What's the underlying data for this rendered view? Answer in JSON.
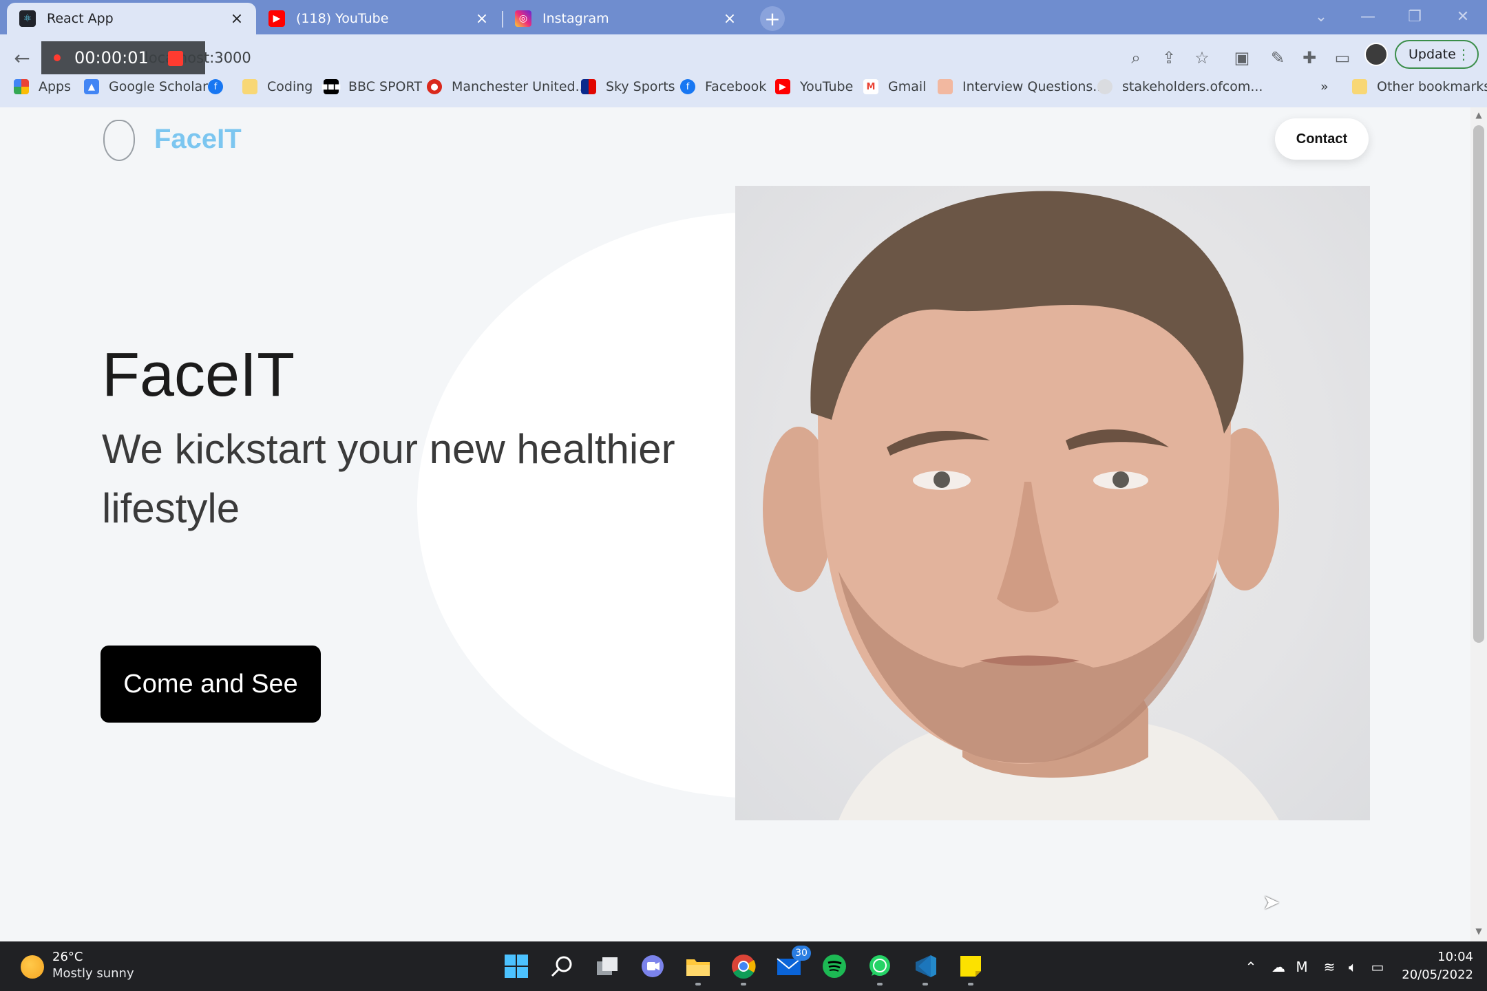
{
  "browser": {
    "tabs": [
      {
        "title": "React App"
      },
      {
        "title": "(118) YouTube"
      },
      {
        "title": "Instagram"
      }
    ],
    "url": "localhost:3000",
    "recorder_time": "00:00:01",
    "update_label": "Update",
    "bookmarks": [
      {
        "label": "Apps"
      },
      {
        "label": "Google Scholar"
      },
      {
        "label": ""
      },
      {
        "label": "Coding"
      },
      {
        "label": "BBC SPORT"
      },
      {
        "label": "Manchester United..."
      },
      {
        "label": "Sky Sports"
      },
      {
        "label": "Facebook"
      },
      {
        "label": "YouTube"
      },
      {
        "label": "Gmail"
      },
      {
        "label": "Interview Questions..."
      },
      {
        "label": "stakeholders.ofcom..."
      }
    ],
    "bookmarks_overflow": "»",
    "other_bookmarks": "Other bookmarks"
  },
  "page": {
    "logo_text": "FaceIT",
    "contact_label": "Contact",
    "hero_title": "FaceIT",
    "hero_subtitle": "We kickstart your new healthier lifestyle",
    "cta_label": "Come and See"
  },
  "taskbar": {
    "weather_temp": "26°C",
    "weather_desc": "Mostly sunny",
    "mail_badge": "30",
    "time": "10:04",
    "date": "20/05/2022"
  },
  "colors": {
    "tabstrip": "#6f8dcf",
    "toolbar": "#dee6f6",
    "brand": "#7cc6f0",
    "cta": "#000000",
    "page_bg": "#f4f6f8"
  }
}
